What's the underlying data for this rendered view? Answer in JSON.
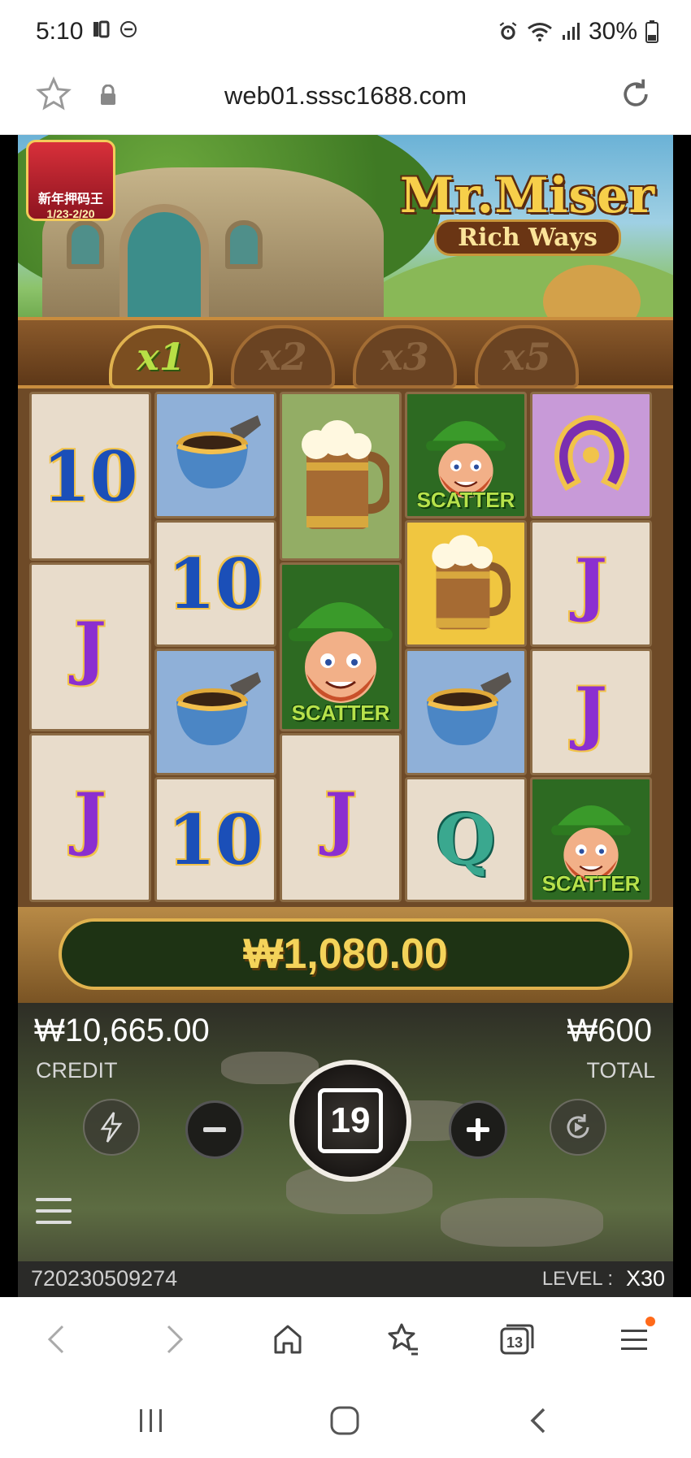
{
  "status_bar": {
    "time": "5:10",
    "battery": "30%",
    "icons": [
      "alarm-icon",
      "wifi-icon",
      "signal-icon",
      "battery-icon"
    ]
  },
  "browser": {
    "url": "web01.sssc1688.com"
  },
  "game": {
    "title_line1": "Mr.Miser",
    "title_line2": "Rich Ways",
    "promo": {
      "line1": "新年押码王",
      "line2": "1/23-2/20"
    },
    "multipliers": [
      {
        "label": "x1",
        "active": true
      },
      {
        "label": "x2",
        "active": false
      },
      {
        "label": "x3",
        "active": false
      },
      {
        "label": "x5",
        "active": false
      }
    ],
    "scatter_label": "SCATTER",
    "reels": [
      [
        {
          "symbol": "10",
          "kind": "ten"
        },
        {
          "symbol": "J",
          "kind": "jack"
        },
        {
          "symbol": "J",
          "kind": "jack"
        }
      ],
      [
        {
          "symbol": "pipe",
          "kind": "pipe"
        },
        {
          "symbol": "10",
          "kind": "ten"
        },
        {
          "symbol": "pipe",
          "kind": "pipe"
        },
        {
          "symbol": "10",
          "kind": "ten"
        }
      ],
      [
        {
          "symbol": "beer",
          "kind": "beer-green"
        },
        {
          "symbol": "scatter",
          "kind": "scatter"
        },
        {
          "symbol": "J",
          "kind": "jack"
        }
      ],
      [
        {
          "symbol": "scatter",
          "kind": "scatter"
        },
        {
          "symbol": "beer",
          "kind": "beer-gold"
        },
        {
          "symbol": "pipe",
          "kind": "pipe"
        },
        {
          "symbol": "Q",
          "kind": "queen"
        }
      ],
      [
        {
          "symbol": "horseshoe",
          "kind": "horseshoe"
        },
        {
          "symbol": "J",
          "kind": "jack"
        },
        {
          "symbol": "J",
          "kind": "jack"
        },
        {
          "symbol": "scatter",
          "kind": "scatter"
        }
      ]
    ],
    "win_amount": "₩1,080.00",
    "credit_amount": "₩10,665.00",
    "credit_label": "CREDIT",
    "total_amount": "₩600",
    "total_label": "TOTAL",
    "spin_count": "19",
    "round_id": "720230509274",
    "level_label": "LEVEL :",
    "level_value": "X30"
  },
  "bottom_nav": {
    "tab_count": "13",
    "items": [
      "back-icon",
      "forward-icon",
      "home-icon",
      "bookmarks-icon",
      "tabs-icon",
      "menu-icon"
    ]
  },
  "system_nav": {
    "items": [
      "recent-apps-icon",
      "home-icon",
      "back-icon"
    ]
  }
}
